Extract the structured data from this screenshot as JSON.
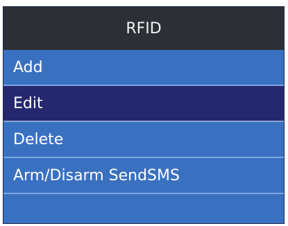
{
  "screen": {
    "title": "RFID",
    "menu_items": [
      {
        "label": "Add",
        "selected": false
      },
      {
        "label": "Edit",
        "selected": true
      },
      {
        "label": "Delete",
        "selected": false
      },
      {
        "label": "Arm/Disarm SendSMS",
        "selected": false
      },
      {
        "label": "",
        "selected": false
      }
    ]
  },
  "colors": {
    "title_bg": "#2c2f35",
    "menu_bg": "#3a70c0",
    "selected_bg": "#25286f",
    "text": "#ffffff"
  }
}
